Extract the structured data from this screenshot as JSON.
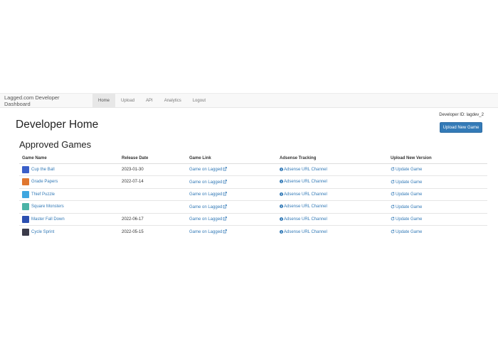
{
  "navbar": {
    "brand": "Lagged.com Developer Dashboard",
    "items": [
      {
        "label": "Home",
        "active": true
      },
      {
        "label": "Upload",
        "active": false
      },
      {
        "label": "API",
        "active": false
      },
      {
        "label": "Analytics",
        "active": false
      },
      {
        "label": "Logout",
        "active": false
      }
    ]
  },
  "header": {
    "developer_id": "Developer ID: lagdev_2",
    "upload_button": "Upload New Game",
    "title": "Developer Home"
  },
  "approved": {
    "title": "Approved Games",
    "columns": [
      "Game Name",
      "Release Date",
      "Game Link",
      "Adsense Tracking",
      "Upload New Version"
    ],
    "game_link_label": "Game on Lagged",
    "adsense_label": "Adsense URL Channel",
    "update_label": "Update Game",
    "rows": [
      {
        "name": "Cup the Ball",
        "date": "2023-01-30",
        "thumb_color": "#3a5fc8"
      },
      {
        "name": "Grade Papers",
        "date": "2022-07-14",
        "thumb_color": "#e0772f"
      },
      {
        "name": "Thief Puzzle",
        "date": "",
        "thumb_color": "#3fa7e0"
      },
      {
        "name": "Square Monsters",
        "date": "",
        "thumb_color": "#4bb3a6"
      },
      {
        "name": "Master Fall Down",
        "date": "2022-06-17",
        "thumb_color": "#2c4fb0"
      },
      {
        "name": "Cycle Sprint",
        "date": "2022-05-15",
        "thumb_color": "#3b3b4a"
      }
    ]
  },
  "colors": {
    "accent": "#337ab7",
    "navbar_bg": "#f8f8f8"
  },
  "icons": {
    "external_link": "external-link-icon",
    "info": "info-circle-icon",
    "refresh": "refresh-icon"
  }
}
